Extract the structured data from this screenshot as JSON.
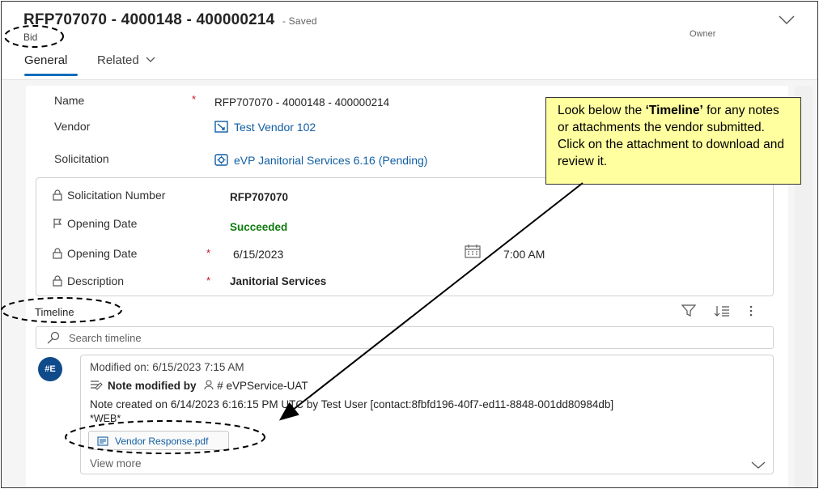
{
  "header": {
    "title": "RFP707070 - 4000148 - 400000214",
    "save_status": "- Saved",
    "entity_type": "Bid",
    "owner_label": "Owner"
  },
  "tabs": [
    {
      "label": "General",
      "selected": true
    },
    {
      "label": "Related",
      "selected": false
    }
  ],
  "fields": {
    "name_label": "Name",
    "name_value": "RFP707070 - 4000148 - 400000214",
    "vendor_label": "Vendor",
    "vendor_value": "Test Vendor 102",
    "solicitation_label": "Solicitation",
    "solicitation_value": "eVP Janitorial Services 6.16 (Pending)"
  },
  "subsection": {
    "solicitation_number_label": "Solicitation Number",
    "solicitation_number_value": "RFP707070",
    "opening_status_label": "Opening Date",
    "opening_status_value": "Succeeded",
    "opening_date_label": "Opening Date",
    "opening_date_value": "6/15/2023",
    "opening_time_value": "7:00 AM",
    "description_label": "Description",
    "description_value": "Janitorial Services"
  },
  "required_marker": "*",
  "timeline": {
    "title": "Timeline",
    "search_placeholder": "Search timeline",
    "entry": {
      "avatar_initials": "#E",
      "modified_on": "Modified on: 6/15/2023 7:15 AM",
      "note_modified_by": "Note modified by",
      "modified_by_user": "# eVPService-UAT",
      "body_line1": "Note created on 6/14/2023 6:16:15 PM UTC by Test User [contact:8fbfd196-40f7-ed11-8848-001dd80984db]",
      "body_line2": "*WEB*",
      "attachment_name": "Vendor Response.pdf",
      "view_more": "View more"
    }
  },
  "callout": {
    "text_before": "Look below the ",
    "text_bold": "‘Timeline’",
    "text_after": " for any notes or attachments the vendor submitted.  Click on the attachment to download and review it."
  },
  "colors": {
    "accent": "#0f6cbd",
    "link": "#115ea3",
    "required": "#c50f1f",
    "success": "#107c10",
    "callout_bg": "#ffffa0",
    "avatar_bg": "#0f4a8a"
  }
}
